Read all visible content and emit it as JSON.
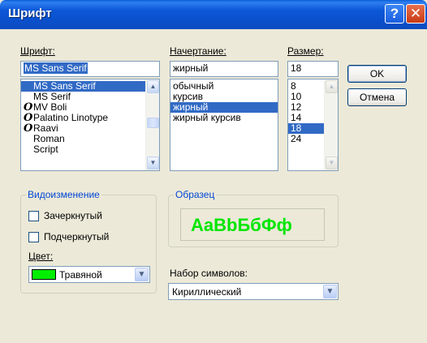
{
  "window": {
    "title": "Шрифт",
    "help_glyph": "?",
    "close_glyph": "✕"
  },
  "font": {
    "label": "Шрифт:",
    "value": "MS Sans Serif",
    "items": [
      {
        "icon": "",
        "name": "MS Sans Serif"
      },
      {
        "icon": "",
        "name": "MS Serif"
      },
      {
        "icon": "O",
        "name": "MV Boli"
      },
      {
        "icon": "O",
        "name": "Palatino Linotype"
      },
      {
        "icon": "O",
        "name": "Raavi"
      },
      {
        "icon": "",
        "name": "Roman"
      },
      {
        "icon": "",
        "name": "Script"
      }
    ],
    "selected": "MS Sans Serif"
  },
  "style": {
    "label": "Начертание:",
    "value": "жирный",
    "items": [
      "обычный",
      "курсив",
      "жирный",
      "жирный курсив"
    ],
    "selected": "жирный"
  },
  "size": {
    "label": "Размер:",
    "value": "18",
    "items": [
      "8",
      "10",
      "12",
      "14",
      "18",
      "24"
    ],
    "selected": "18"
  },
  "buttons": {
    "ok": "OK",
    "cancel": "Отмена"
  },
  "effects": {
    "group_title": "Видоизменение",
    "strikeout_label": "Зачеркнутый",
    "underline_label": "Подчеркнутый",
    "color_label": "Цвет:",
    "color_value": "Травяной",
    "color_swatch": "#00ee00"
  },
  "sample": {
    "group_title": "Образец",
    "text": "AaBbБбФф",
    "color": "#00e600"
  },
  "charset": {
    "label": "Набор символов:",
    "value": "Кириллический"
  }
}
